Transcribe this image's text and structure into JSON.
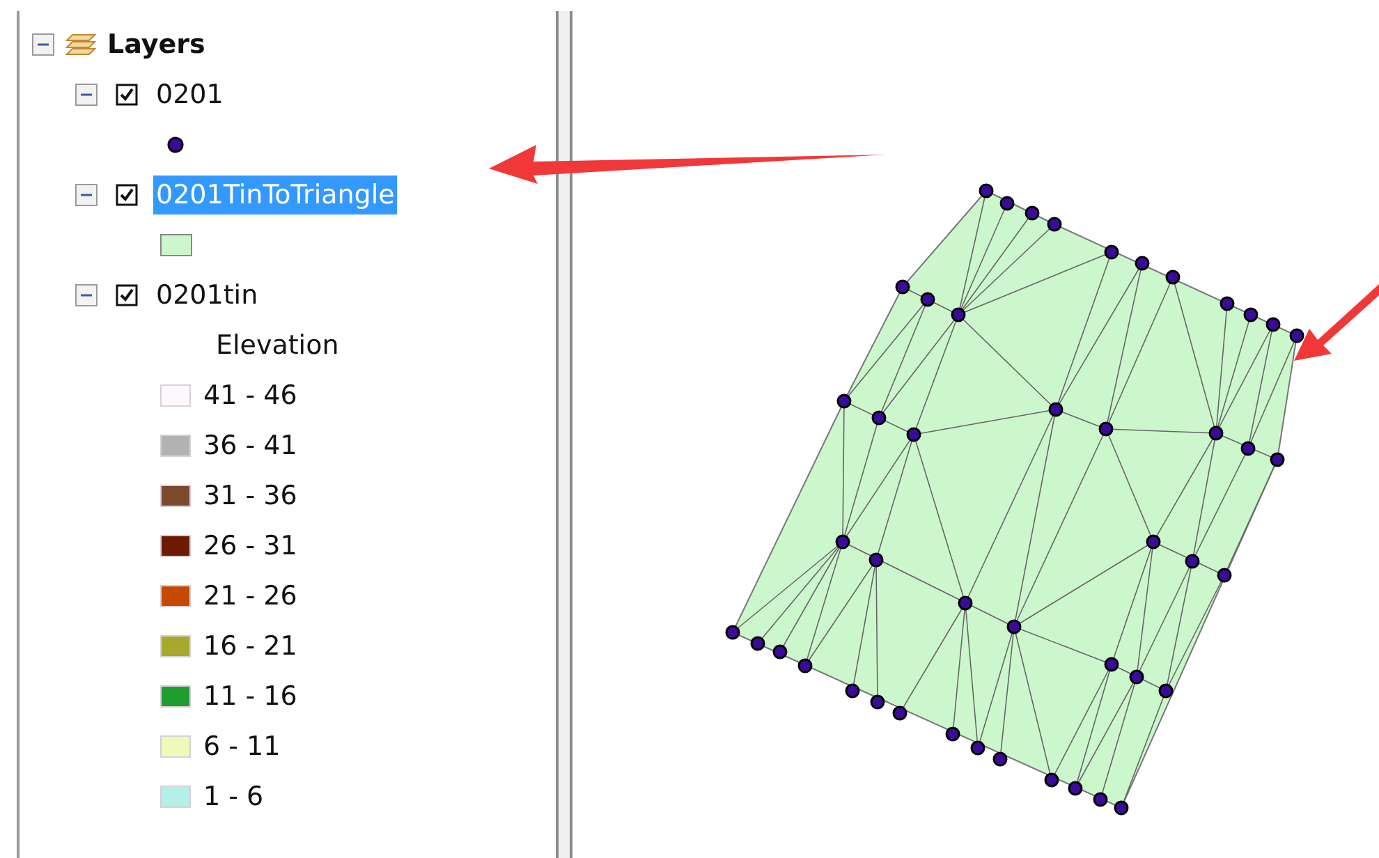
{
  "toc": {
    "root": {
      "label": "Layers",
      "expanded": true
    },
    "layers": [
      {
        "name": "0201",
        "kind": "point",
        "expanded": true,
        "checked": true,
        "selected": false
      },
      {
        "name": "0201TinToTriangle",
        "kind": "fill",
        "expanded": true,
        "checked": true,
        "selected": true
      },
      {
        "name": "0201tin",
        "kind": "ramp",
        "expanded": true,
        "checked": true,
        "selected": false,
        "field": "Elevation",
        "classes": [
          {
            "label": "41 - 46",
            "color": "#fcf8fc"
          },
          {
            "label": "36 - 41",
            "color": "#b2b2b2"
          },
          {
            "label": "31 - 36",
            "color": "#7a4a2a"
          },
          {
            "label": "26 - 31",
            "color": "#6e1a00"
          },
          {
            "label": "21 - 26",
            "color": "#c44a00"
          },
          {
            "label": "16 - 21",
            "color": "#a8a82a"
          },
          {
            "label": "11 - 16",
            "color": "#1f9e2f"
          },
          {
            "label": "6 - 11",
            "color": "#eefab8"
          },
          {
            "label": "1 - 6",
            "color": "#b2f0e8"
          }
        ]
      }
    ]
  }
}
